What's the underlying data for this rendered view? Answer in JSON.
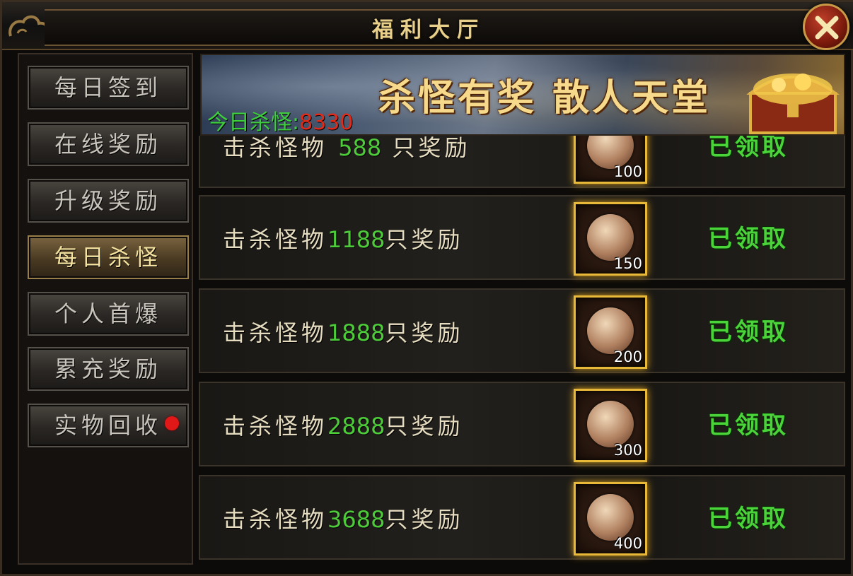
{
  "window": {
    "title": "福利大厅"
  },
  "sidebar": {
    "items": [
      {
        "label": "每日签到",
        "active": false
      },
      {
        "label": "在线奖励",
        "active": false
      },
      {
        "label": "升级奖励",
        "active": false
      },
      {
        "label": "每日杀怪",
        "active": true
      },
      {
        "label": "个人首爆",
        "active": false
      },
      {
        "label": "累充奖励",
        "active": false
      },
      {
        "label": "实物回收",
        "active": false,
        "badge": "red-dot"
      }
    ]
  },
  "banner": {
    "slogan": "杀怪有奖 散人天堂",
    "kill_label": "今日杀怪:",
    "kill_value": "8330"
  },
  "rewards": [
    {
      "prefix": "击杀怪物",
      "count": "588",
      "suffix": "只奖励",
      "qty": "100",
      "status": "已领取"
    },
    {
      "prefix": "击杀怪物",
      "count": "1188",
      "suffix": "只奖励",
      "qty": "150",
      "status": "已领取"
    },
    {
      "prefix": "击杀怪物",
      "count": "1888",
      "suffix": "只奖励",
      "qty": "200",
      "status": "已领取"
    },
    {
      "prefix": "击杀怪物",
      "count": "2888",
      "suffix": "只奖励",
      "qty": "300",
      "status": "已领取"
    },
    {
      "prefix": "击杀怪物",
      "count": "3688",
      "suffix": "只奖励",
      "qty": "400",
      "status": "已领取"
    }
  ],
  "colors": {
    "count_green": "#4ecb3a",
    "claimed_green": "#4ad43a",
    "kill_value_red": "#e02a1a",
    "gold_frame": "#e8b838"
  }
}
